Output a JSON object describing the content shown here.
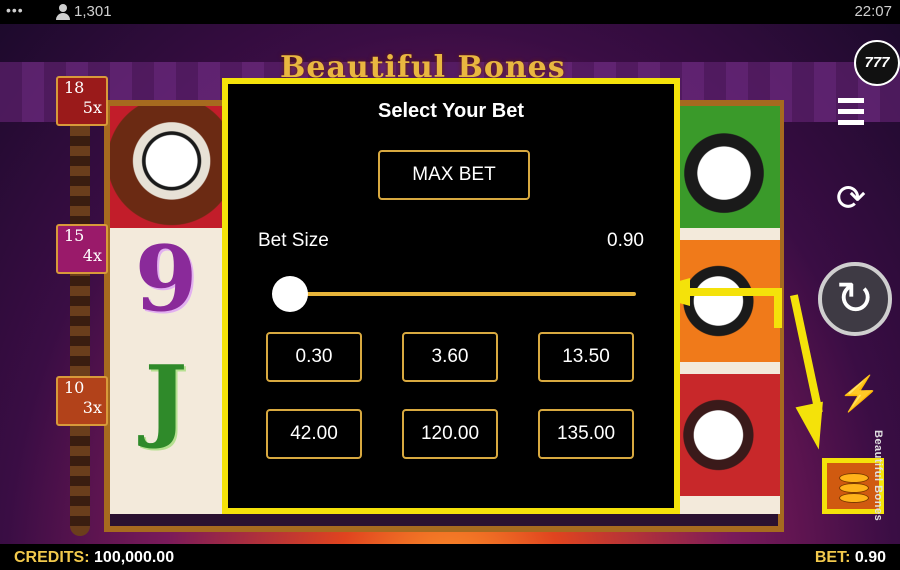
{
  "status": {
    "menu_dots": "•••",
    "players_count": "1,301",
    "time": "22:07"
  },
  "game": {
    "logo_text": "Beautiful Bones",
    "vertical_title": "Beautiful Bones",
    "multipliers": [
      {
        "top": "18",
        "bot": "5x"
      },
      {
        "top": "15",
        "bot": "4x"
      },
      {
        "top": "10",
        "bot": "3x"
      }
    ],
    "reel_symbols": [
      "9",
      "J"
    ],
    "buttons": {
      "jackpot": "777",
      "autoplay_icon": "⟳",
      "spin_icon": "↻",
      "turbo_icon": "⚡"
    }
  },
  "bet_panel": {
    "title": "Select Your Bet",
    "max_bet_label": "MAX BET",
    "bet_size_label": "Bet Size",
    "bet_size_value": "0.90",
    "slider_value": 0.0,
    "options": [
      "0.30",
      "3.60",
      "13.50",
      "42.00",
      "120.00",
      "135.00"
    ]
  },
  "footer": {
    "credits_label": "CREDITS:",
    "credits_value": "100,000.00",
    "bet_label": "BET:",
    "bet_value": "0.90"
  },
  "colors": {
    "highlight": "#f4e20a",
    "button_border": "#d8a940",
    "label_gold": "#f2c94c"
  }
}
